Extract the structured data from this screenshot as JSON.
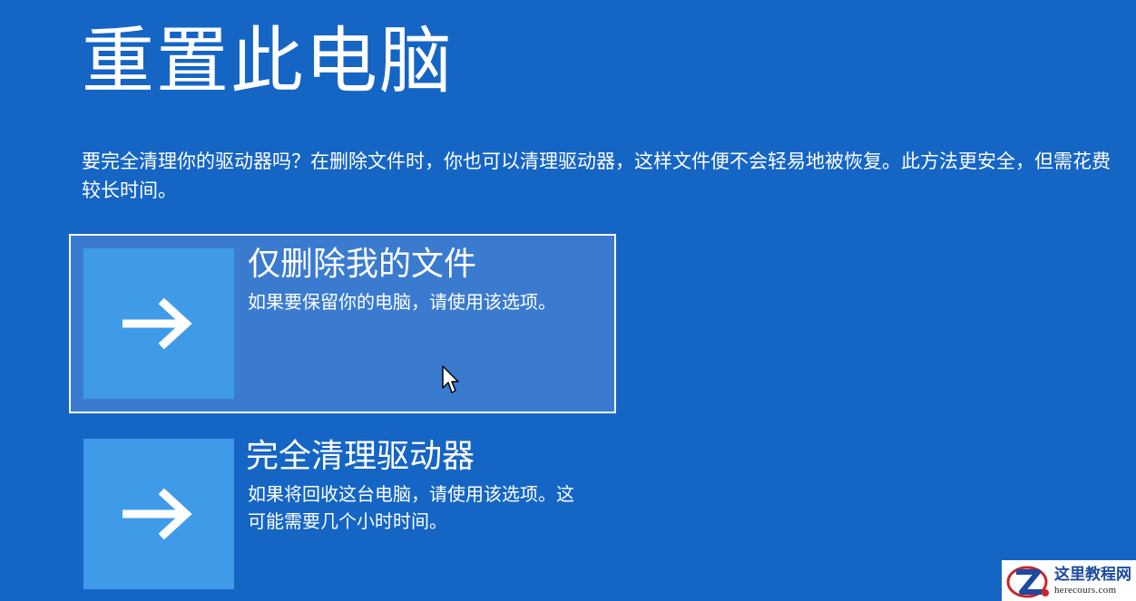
{
  "page": {
    "title": "重置此电脑",
    "description": "要完全清理你的驱动器吗？在删除文件时，你也可以清理驱动器，这样文件便不会轻易地被恢复。此方法更安全，但需花费较长时间。"
  },
  "options": [
    {
      "title": "仅删除我的文件",
      "description": "如果要保留你的电脑，请使用该选项。",
      "icon": "arrow-right-icon",
      "selected": true
    },
    {
      "title": "完全清理驱动器",
      "description": "如果将回收这台电脑，请使用该选项。这可能需要几个小时时间。",
      "icon": "arrow-right-icon",
      "selected": false
    }
  ],
  "watermark": {
    "title": "这里教程网",
    "url": "herecours.com"
  },
  "colors": {
    "background": "#1565c5",
    "tile": "#3f9be8",
    "selected_background": "#3a7bd0",
    "text": "#ffffff"
  }
}
